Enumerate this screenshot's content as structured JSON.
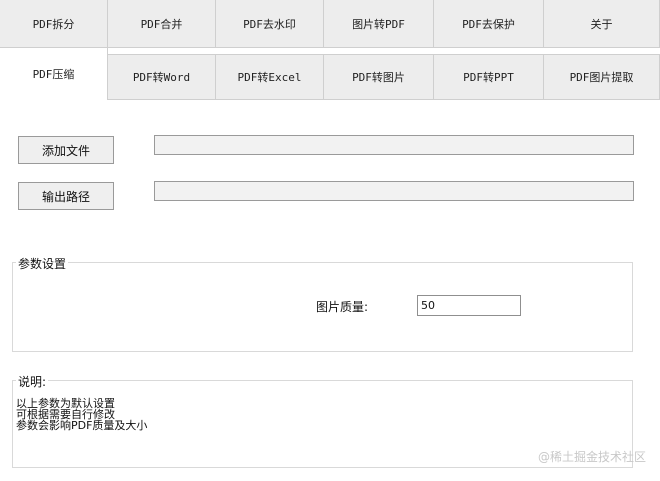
{
  "tabs_row1": [
    {
      "label": "PDF拆分"
    },
    {
      "label": "PDF合并"
    },
    {
      "label": "PDF去水印"
    },
    {
      "label": "图片转PDF"
    },
    {
      "label": "PDF去保护"
    },
    {
      "label": "关于"
    }
  ],
  "tabs_row2": [
    {
      "label": "PDF压缩",
      "active": true
    },
    {
      "label": "PDF转Word"
    },
    {
      "label": "PDF转Excel"
    },
    {
      "label": "PDF转图片"
    },
    {
      "label": "PDF转PPT"
    },
    {
      "label": "PDF图片提取"
    }
  ],
  "buttons": {
    "add_file": "添加文件",
    "output_path": "输出路径"
  },
  "fields": {
    "file_path": "",
    "output_path": ""
  },
  "params": {
    "title": "参数设置",
    "quality_label": "图片质量:",
    "quality_value": "50"
  },
  "description": {
    "title": "说明:",
    "lines": [
      "以上参数为默认设置",
      "可根据需要自行修改",
      "参数会影响PDF质量及大小"
    ]
  },
  "watermark": "@稀土掘金技术社区"
}
